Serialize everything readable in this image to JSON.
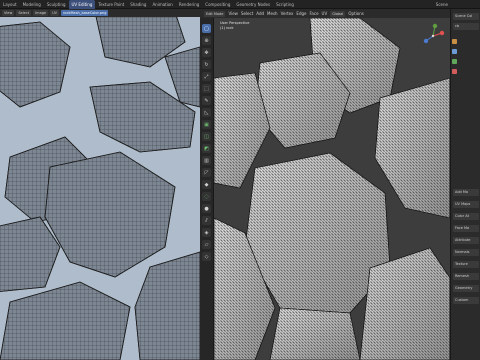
{
  "workspace_tabs": [
    "Layout",
    "Modeling",
    "Sculpting",
    "UV Editing",
    "Texture Paint",
    "Shading",
    "Animation",
    "Rendering",
    "Compositing",
    "Geometry Nodes",
    "Scripting"
  ],
  "active_tab": "UV Editing",
  "scene_label": "Scene",
  "uv_editor": {
    "menus": [
      "View",
      "Select",
      "Image",
      "UV"
    ],
    "image_name": "rockMesh_baseColor.png"
  },
  "viewport": {
    "mode": "Edit Mode",
    "menus": [
      "View",
      "Select",
      "Add",
      "Mesh",
      "Vertex",
      "Edge",
      "Face",
      "UV"
    ],
    "transform": "Global",
    "options": "Options",
    "overlay_line1": "User Perspective",
    "overlay_line2": "(1) rock"
  },
  "properties": {
    "rows": [
      "Scene Col",
      "cb",
      "Add Mo",
      "UV Maps",
      "Color At",
      "Face Ma",
      "Attribute",
      "Normals",
      "Texture",
      "Remesh",
      "Geometry",
      "Custom"
    ]
  },
  "colors": {
    "accent": "#4a6ea9",
    "uv_background": "#aebccb",
    "island_fill": "#7d8794",
    "mesh_fill": "#d9d9d9",
    "wire": "#222222"
  }
}
